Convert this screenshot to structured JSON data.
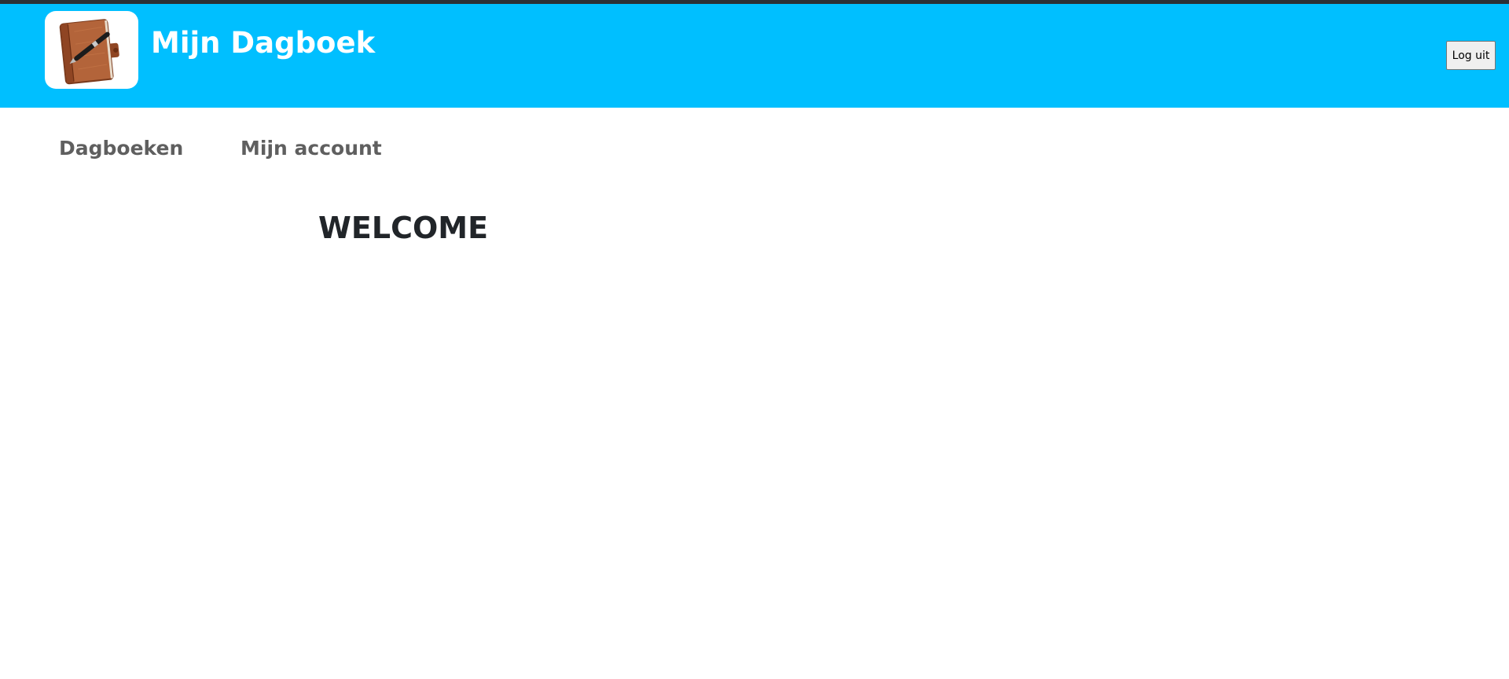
{
  "header": {
    "app_title": "Mijn Dagboek",
    "logo_icon": "notebook-pen-icon",
    "logout_label": "Log uit",
    "background_color": "#00bfff"
  },
  "nav": {
    "items": [
      {
        "label": "Dagboeken"
      },
      {
        "label": "Mijn account"
      }
    ]
  },
  "main": {
    "heading": "WELCOME"
  }
}
